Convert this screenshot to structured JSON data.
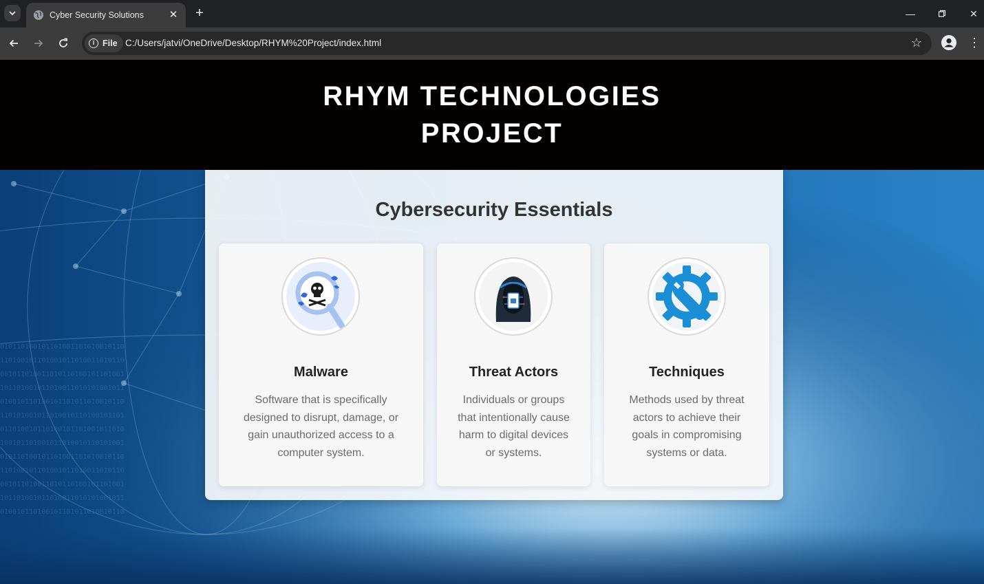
{
  "browser": {
    "tab_title": "Cyber Security Solutions",
    "site_chip": "File",
    "url": "C:/Users/jatvi/OneDrive/Desktop/RHYM%20Project/index.html",
    "icons": {
      "tab_list": "chevron-down-icon",
      "tab_favicon": "globe-icon",
      "tab_close": "close-icon",
      "new_tab": "plus-icon",
      "back": "arrow-left-icon",
      "forward": "arrow-right-icon",
      "reload": "reload-icon",
      "site_info": "info-icon",
      "bookmark": "star-icon",
      "profile": "profile-icon",
      "menu": "kebab-menu-icon",
      "minimize": "minimize-icon",
      "restore": "restore-icon",
      "close_window": "close-icon"
    }
  },
  "header": {
    "title": "RHYM TECHNOLOGIES PROJECT"
  },
  "main": {
    "heading": "Cybersecurity Essentials",
    "cards": [
      {
        "title": "Malware",
        "description": "Software that is specifically designed to disrupt, damage, or gain unauthorized access to a computer system.",
        "icon": "malware-skull-magnifier-icon"
      },
      {
        "title": "Threat Actors",
        "description": "Individuals or groups that intentionally cause harm to digital devices or systems.",
        "icon": "hooded-hacker-icon"
      },
      {
        "title": "Techniques",
        "description": "Methods used by threat actors to achieve their goals in compromising systems or data.",
        "icon": "gear-wrench-icon"
      }
    ]
  },
  "colors": {
    "chrome_dark": "#202124",
    "chrome_toolbar": "#3c3c3c",
    "header_bg": "#050000",
    "accent_blue": "#1a8fd6",
    "background_blue": "#0d4f8c"
  }
}
